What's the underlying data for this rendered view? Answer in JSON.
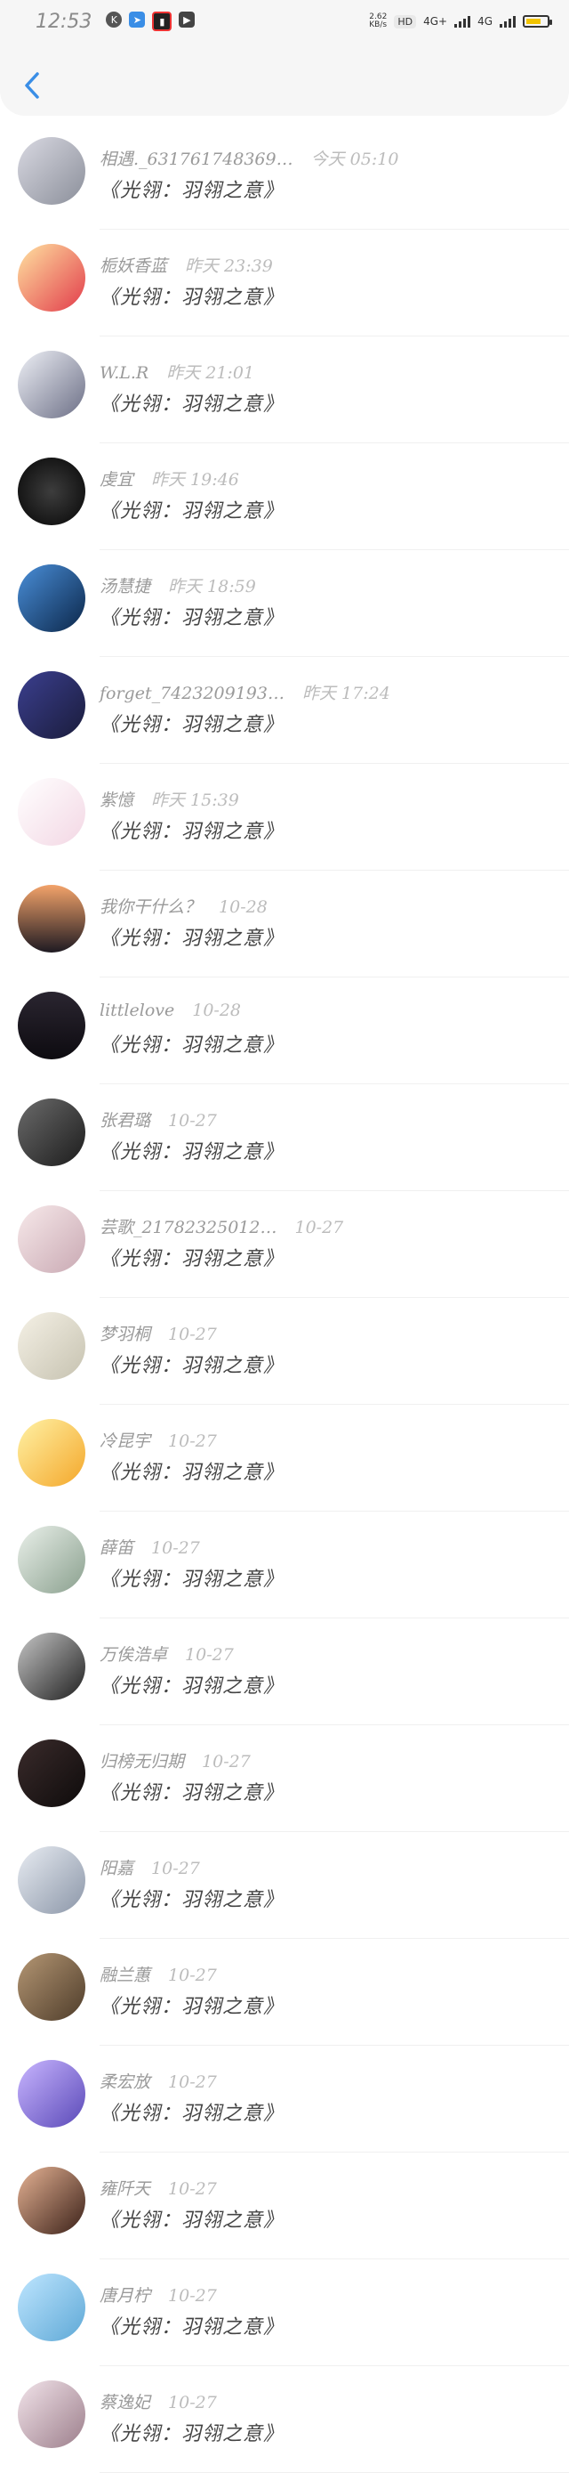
{
  "status_bar": {
    "time": "12:53",
    "net_speed": "2.62\nKB/s",
    "hd": "HD",
    "signal1": "4G+",
    "signal2": "4G",
    "battery_icon": "battery-icon"
  },
  "header": {
    "back_icon": "chevron-left-icon"
  },
  "colors": {
    "accent": "#3a8ee6",
    "name_gray": "#9a9a9a",
    "time_gray": "#bcbcbc"
  },
  "items": [
    {
      "name": "相遇._6317617483​69…",
      "time": "今天 05:10",
      "title": "《光翎：羽翎之意》",
      "bg": "linear-gradient(135deg,#d9d9e2,#8b8f9a)"
    },
    {
      "name": "栀妖香蓝",
      "time": "昨天 23:39",
      "title": "《光翎：羽翎之意》",
      "bg": "linear-gradient(135deg,#ffe3a1,#e23b4a)"
    },
    {
      "name": "W.L.R",
      "time": "昨天 21:01",
      "title": "《光翎：羽翎之意》",
      "bg": "linear-gradient(135deg,#eef0f6,#6c6f86)"
    },
    {
      "name": "虔宜",
      "time": "昨天 19:46",
      "title": "《光翎：羽翎之意》",
      "bg": "radial-gradient(circle,#3d3d3d,#050505)"
    },
    {
      "name": "汤慧捷",
      "time": "昨天 18:59",
      "title": "《光翎：羽翎之意》",
      "bg": "linear-gradient(135deg,#4a8fd9,#0b2649)"
    },
    {
      "name": "forget_7423209193…",
      "time": "昨天 17:24",
      "title": "《光翎：羽翎之意》",
      "bg": "linear-gradient(135deg,#3b3f8f,#1a1c3b)"
    },
    {
      "name": "紫憶",
      "time": "昨天 15:39",
      "title": "《光翎：羽翎之意》",
      "bg": "linear-gradient(135deg,#ffffff,#f3d7e4)"
    },
    {
      "name": "我你干什么？",
      "time": "10-28",
      "title": "《光翎：羽翎之意》",
      "bg": "linear-gradient(180deg,#f3a36a,#1e1a22)"
    },
    {
      "name": "littlelove",
      "time": "10-28",
      "title": "《光翎：羽翎之意》",
      "bg": "linear-gradient(180deg,#2a2530,#0d0b10)"
    },
    {
      "name": "张君璐",
      "time": "10-27",
      "title": "《光翎：羽翎之意》",
      "bg": "linear-gradient(135deg,#6b6b6b,#1c1c1c)"
    },
    {
      "name": "芸歌_21782325012…",
      "time": "10-27",
      "title": "《光翎：羽翎之意》",
      "bg": "linear-gradient(135deg,#f7e9ea,#c9a9b3)"
    },
    {
      "name": "梦羽桐",
      "time": "10-27",
      "title": "《光翎：羽翎之意》",
      "bg": "linear-gradient(135deg,#f5f1e6,#c6c2b0)"
    },
    {
      "name": "冷昆宇",
      "time": "10-27",
      "title": "《光翎：羽翎之意》",
      "bg": "linear-gradient(135deg,#fff2a6,#f4a72a)"
    },
    {
      "name": "薛笛",
      "time": "10-27",
      "title": "《光翎：羽翎之意》",
      "bg": "linear-gradient(135deg,#eaf0ea,#8aa08e)"
    },
    {
      "name": "万俟浩卓",
      "time": "10-27",
      "title": "《光翎：羽翎之意》",
      "bg": "linear-gradient(135deg,#c6c6c6,#1f1f1f)"
    },
    {
      "name": "归榜无归期",
      "time": "10-27",
      "title": "《光翎：羽翎之意》",
      "bg": "linear-gradient(135deg,#3a2b2b,#0e0b0b)"
    },
    {
      "name": "阳嘉",
      "time": "10-27",
      "title": "《光翎：羽翎之意》",
      "bg": "linear-gradient(135deg,#e8ecf2,#8b96a8)"
    },
    {
      "name": "融兰蕙",
      "time": "10-27",
      "title": "《光翎：羽翎之意》",
      "bg": "linear-gradient(135deg,#b59774,#4e3c2a)"
    },
    {
      "name": "柔宏放",
      "time": "10-27",
      "title": "《光翎：羽翎之意》",
      "bg": "linear-gradient(135deg,#c9b6ff,#5a49b8)"
    },
    {
      "name": "雍阡天",
      "time": "10-27",
      "title": "《光翎：羽翎之意》",
      "bg": "linear-gradient(135deg,#e6b394,#3a2018)"
    },
    {
      "name": "唐月柠",
      "time": "10-27",
      "title": "《光翎：羽翎之意》",
      "bg": "linear-gradient(135deg,#bfe6ff,#5ea8d6)"
    },
    {
      "name": "蔡逸妃",
      "time": "10-27",
      "title": "《光翎：羽翎之意》",
      "bg": "linear-gradient(135deg,#f2e4ea,#9c7e8b)"
    }
  ]
}
